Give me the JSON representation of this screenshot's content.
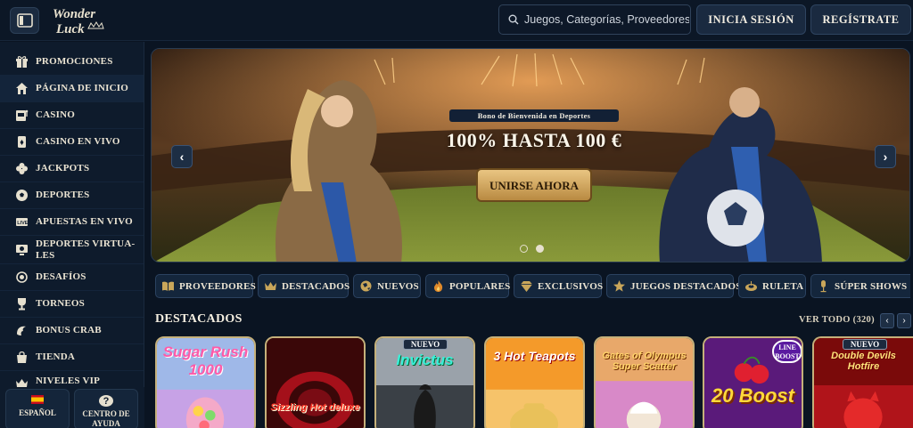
{
  "header": {
    "logo_text_1": "Wonder",
    "logo_text_2": "Luck",
    "search_placeholder": "Juegos, Categorías, Proveedores",
    "login_label": "INICIA SESIÓN",
    "register_label": "REGÍSTRATE"
  },
  "sidebar": {
    "items": [
      {
        "label": "PROMOCIONES",
        "icon": "gift-icon"
      },
      {
        "label": "PÁGINA DE INICIO",
        "icon": "home-icon",
        "active": true
      },
      {
        "label": "CASINO",
        "icon": "slot-machine-icon"
      },
      {
        "label": "CASINO EN VIVO",
        "icon": "cards-icon"
      },
      {
        "label": "JACKPOTS",
        "icon": "clover-icon"
      },
      {
        "label": "DEPORTES",
        "icon": "soccer-ball-icon"
      },
      {
        "label": "APUESTAS EN VIVO",
        "icon": "live-icon"
      },
      {
        "label": "DEPORTES VIRTUA-\nLES",
        "icon": "virtual-sports-icon"
      },
      {
        "label": "DESAFÍOS",
        "icon": "medal-icon"
      },
      {
        "label": "TORNEOS",
        "icon": "trophy-icon"
      },
      {
        "label": "BONUS CRAB",
        "icon": "crab-claw-icon"
      },
      {
        "label": "TIENDA",
        "icon": "shopping-bag-icon"
      },
      {
        "label": "NIVELES VIP",
        "icon": "vip-crown-icon"
      }
    ],
    "language_label": "ESPAÑOL",
    "help_label": "CENTRO DE AYUDA",
    "help_icon_text": "?"
  },
  "banner": {
    "tag": "Bono de Bienvenida en Deportes",
    "title": "100% HASTA 100 €",
    "cta_label": "UNIRSE AHORA",
    "slides": 2,
    "active_slide": 2
  },
  "categories": [
    {
      "label": "PROVEEDORES",
      "icon": "book-icon"
    },
    {
      "label": "DESTACADOS",
      "icon": "crown-icon"
    },
    {
      "label": "NUEVOS",
      "icon": "globe-icon"
    },
    {
      "label": "POPULARES",
      "icon": "fire-icon"
    },
    {
      "label": "EXCLUSIVOS",
      "icon": "diamond-icon"
    },
    {
      "label": "JUEGOS DESTACADOS",
      "icon": "star-icon"
    },
    {
      "label": "RULETA",
      "icon": "roulette-icon"
    },
    {
      "label": "SÚPER SHOWS",
      "icon": "microphone-icon"
    }
  ],
  "section": {
    "title": "Destacados",
    "see_all": "VER TODO (320)",
    "prev": "‹",
    "next": "›"
  },
  "games": [
    {
      "title": "Sugar Rush 1000",
      "badge": ""
    },
    {
      "title": "Sizzling Hot deluxe",
      "badge": ""
    },
    {
      "title": "Invictus",
      "badge": "NUEVO"
    },
    {
      "title": "3 Hot Teapots",
      "badge": ""
    },
    {
      "title": "Gates of Olympus Super Scatter",
      "badge": ""
    },
    {
      "title": "20 Boost",
      "badge": "LINE BOOST"
    },
    {
      "title": "Double Devils Hotfire",
      "badge": "NUEVO"
    }
  ],
  "colors": {
    "background": "#0a1422",
    "sidebar": "#0e1b2c",
    "gold": "#c5b07a",
    "button": "#1a2a40"
  }
}
